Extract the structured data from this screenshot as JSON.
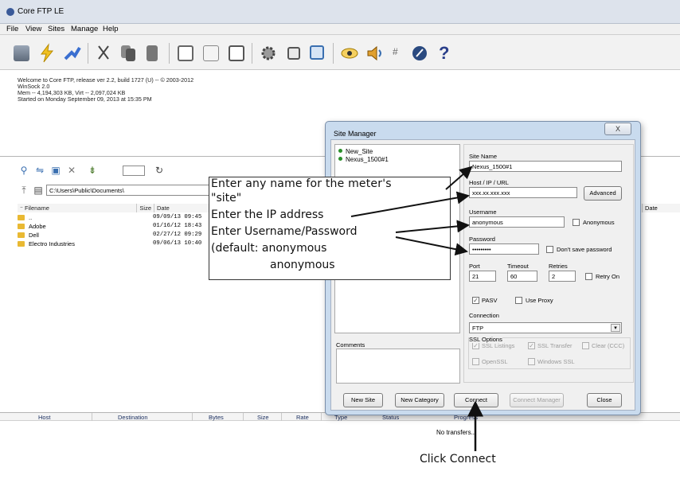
{
  "window": {
    "title": "Core FTP LE"
  },
  "menu": [
    "File",
    "View",
    "Sites",
    "Manage",
    "Help"
  ],
  "toolbar": {
    "icons": [
      "connect-icon",
      "quick-connect-icon",
      "disconnect-icon",
      "cut-icon",
      "copy-icon",
      "paste-icon",
      "view-icon",
      "edit-icon",
      "list-icon",
      "settings-icon",
      "queue-icon",
      "transfer-icon",
      "view-eye-icon",
      "sound-icon",
      "hash-icon",
      "about-icon",
      "help-icon"
    ]
  },
  "log": {
    "lines": [
      "Welcome to Core FTP, release ver 2.2, build 1727 (U) -- © 2003-2012",
      "WinSock 2.0",
      "Mem -- 4,194,303 KB, Virt -- 2,097,024 KB",
      "Started on Monday September 09, 2013 at 15:35 PM"
    ]
  },
  "local": {
    "path": "C:\\Users\\Public\\Documents\\",
    "columns": {
      "filename": "Filename",
      "size": "Size",
      "date": "Date"
    },
    "files": [
      {
        "name": "..",
        "date": "09/09/13 09:45"
      },
      {
        "name": "Adobe",
        "date": "01/16/12 18:43"
      },
      {
        "name": "Dell",
        "date": "02/27/12 09:29"
      },
      {
        "name": "Electro Industries",
        "date": "09/06/13 10:40"
      }
    ]
  },
  "remote": {
    "date_col": "Date"
  },
  "transfers": {
    "columns": [
      "Host",
      "Destination",
      "Bytes",
      "Size",
      "Rate",
      "Type",
      "Status",
      "Progress"
    ],
    "empty": "No transfers..."
  },
  "dialog": {
    "title": "Site Manager",
    "close": "X",
    "tree": [
      "New_Site",
      "Nexus_1500#1"
    ],
    "site_name_label": "Site Name",
    "site_name": "Nexus_1500#1",
    "host_label": "Host / IP / URL",
    "host": "xxx.xx.xxx.xxx",
    "advanced": "Advanced",
    "username_label": "Username",
    "username": "anonymous",
    "anonymous_label": "Anonymous",
    "password_label": "Password",
    "password": "•••••••••",
    "dont_save_label": "Don't save password",
    "port_label": "Port",
    "port": "21",
    "timeout_label": "Timeout",
    "timeout": "60",
    "retries_label": "Retries",
    "retries": "2",
    "retry_on_label": "Retry On",
    "pasv_label": "PASV",
    "use_proxy_label": "Use Proxy",
    "connection_label": "Connection",
    "connection": "FTP",
    "ssl_label": "SSL Options",
    "ssl_listings": "SSL Listings",
    "ssl_transfers": "SSL Transfer",
    "clear_ccc": "Clear (CCC)",
    "openssl": "OpenSSL",
    "windows_ssl": "Windows SSL",
    "comments_label": "Comments",
    "buttons": {
      "new_site": "New Site",
      "new_category": "New Category",
      "connect": "Connect",
      "connect_manager": "Connect Manager",
      "close": "Close"
    }
  },
  "annotation": {
    "line1": "Enter  any  name  for  the  meter's",
    "line2": "\"site\"",
    "line3": "Enter the IP address",
    "line4": "Enter Username/Password",
    "line5": "(default: anonymous",
    "line6": "anonymous",
    "click_connect": "Click Connect"
  }
}
